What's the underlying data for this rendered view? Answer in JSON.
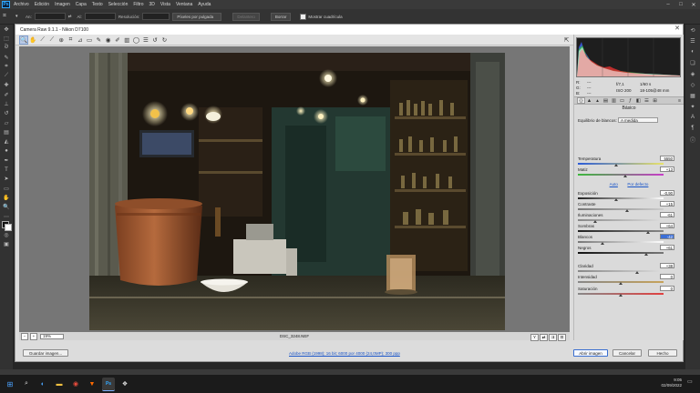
{
  "ps": {
    "logo": "Ps",
    "menus": [
      "Archivo",
      "Edición",
      "Imagen",
      "Capa",
      "Texto",
      "Selección",
      "Filtro",
      "3D",
      "Vista",
      "Ventana",
      "Ayuda"
    ],
    "options": {
      "ancho_label": "An:",
      "alto_label": "Al:",
      "resolucion_label": "Resolución:",
      "unit_select": "Píxeles por pulgada",
      "borrar_frontal": "Delantero",
      "borrar": "Borrar",
      "mostrar_cuadricula": "Mostrar cuadrícula"
    }
  },
  "dialog": {
    "title": "Camera Raw 9.1.1 - Nikon D7100",
    "zoom_value": "19%",
    "filename": "DSC_3248.NEF",
    "workflow_link": "Adobe RGB (1998); 16 bit; 6000 por 4000 (24,0MP); 300 ppp",
    "save_button": "Guardar imagen...",
    "open_button": "Abrir imagen",
    "cancel_button": "Cancelar",
    "done_button": "Hecho"
  },
  "panel": {
    "readout": {
      "r_label": "R:",
      "g_label": "G:",
      "b_label": "B:",
      "r_value": "---",
      "g_value": "---",
      "b_value": "---",
      "aperture": "f/7,1",
      "shutter": "1/60 s",
      "iso": "ISO 200",
      "lens": "18-105@48 mm"
    },
    "section_title": "Básico",
    "wb_label": "Equilibrio de blancos:",
    "wb_value": "A medida",
    "auto_link": "Auto",
    "default_link": "Por defecto",
    "sliders": [
      {
        "label": "Temperatura",
        "value": "5550",
        "pos": 0.45
      },
      {
        "label": "Matiz",
        "value": "+13",
        "pos": 0.55
      },
      {
        "label": "Exposición",
        "value": "-0,90",
        "pos": 0.45
      },
      {
        "label": "Contraste",
        "value": "+15",
        "pos": 0.57
      },
      {
        "label": "Iluminaciones",
        "value": "-61",
        "pos": 0.2
      },
      {
        "label": "Sombras",
        "value": "+64",
        "pos": 0.82
      },
      {
        "label": "Blancos",
        "value": "-42",
        "pos": 0.29
      },
      {
        "label": "Negros",
        "value": "+61",
        "pos": 0.8
      },
      {
        "label": "Claridad",
        "value": "+38",
        "pos": 0.69
      },
      {
        "label": "Intensidad",
        "value": "0",
        "pos": 0.5
      },
      {
        "label": "Saturación",
        "value": "0",
        "pos": 0.5
      }
    ]
  },
  "taskbar": {
    "time": "9:05",
    "date": "02/09/2022"
  }
}
